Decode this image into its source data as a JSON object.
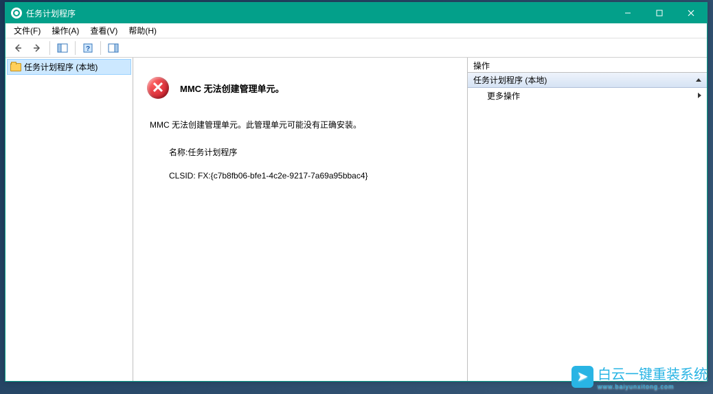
{
  "window": {
    "title": "任务计划程序"
  },
  "menu": {
    "file": "文件(F)",
    "action": "操作(A)",
    "view": "查看(V)",
    "help": "帮助(H)"
  },
  "tree": {
    "root": "任务计划程序 (本地)"
  },
  "error": {
    "title": "MMC 无法创建管理单元。",
    "message": "MMC 无法创建管理单元。此管理单元可能没有正确安装。",
    "name_label": "名称:任务计划程序",
    "clsid": "CLSID: FX:{c7b8fb06-bfe1-4c2e-9217-7a69a95bbac4}"
  },
  "actions": {
    "header": "操作",
    "section": "任务计划程序 (本地)",
    "more": "更多操作"
  },
  "watermark": {
    "text": "白云一键重装系统",
    "url": "www.baiyunxitong.com"
  }
}
